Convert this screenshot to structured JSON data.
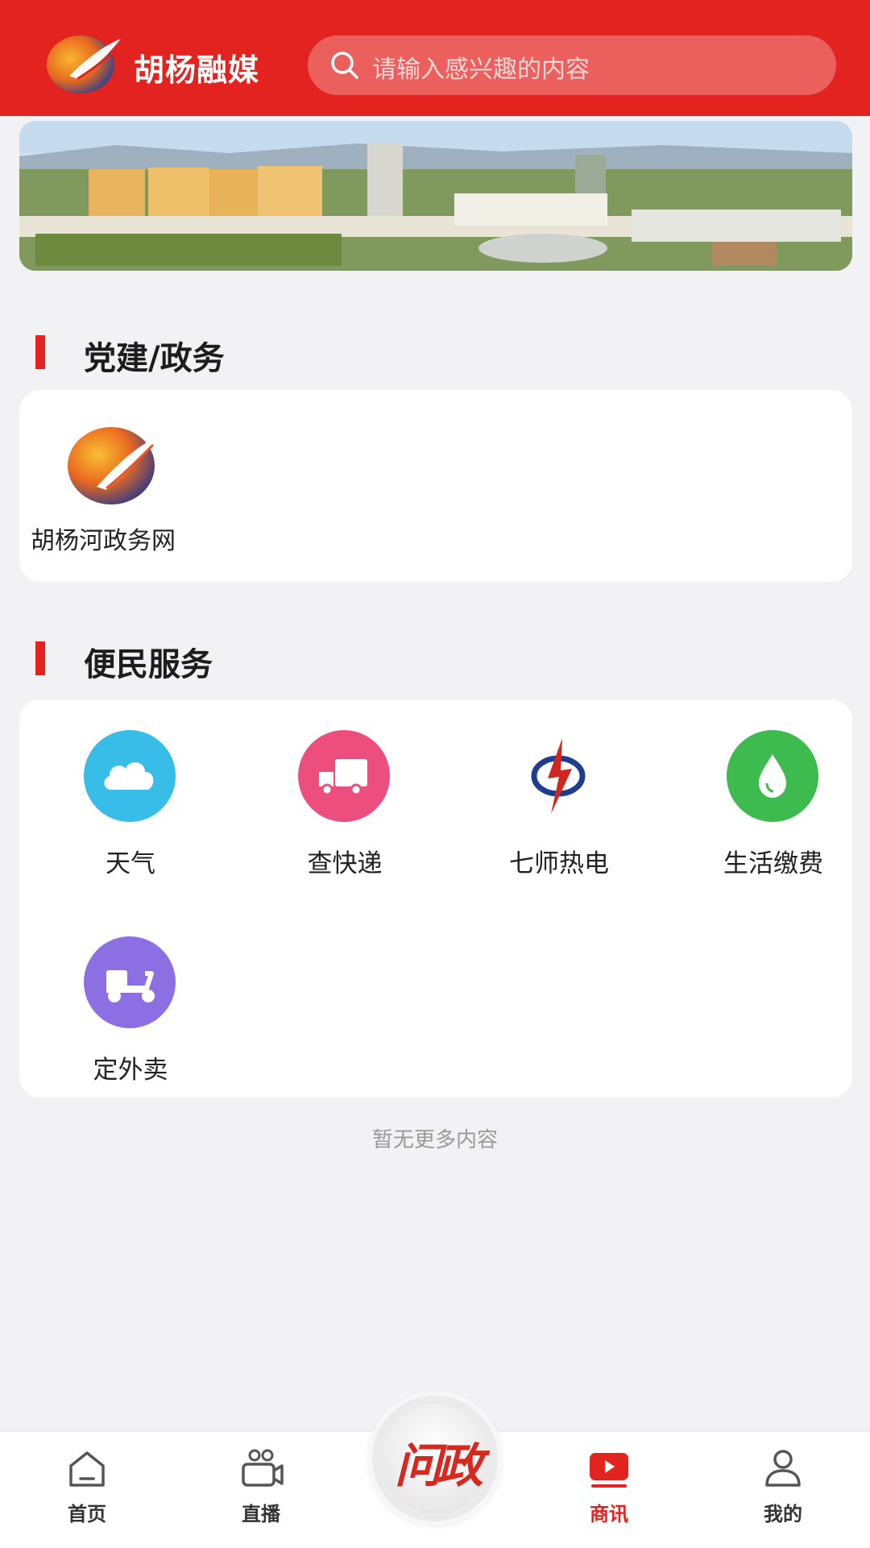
{
  "header": {
    "brand": "胡杨融媒",
    "search_placeholder": "请输入感兴趣的内容"
  },
  "sections": {
    "party": {
      "title": "党建/政务",
      "items": [
        {
          "label": "胡杨河政务网"
        }
      ]
    },
    "services": {
      "title": "便民服务",
      "items": [
        {
          "label": "天气",
          "icon": "cloud-icon",
          "color": "#38bde9"
        },
        {
          "label": "查快递",
          "icon": "delivery-truck-icon",
          "color": "#ec4f7e"
        },
        {
          "label": "七师热电",
          "icon": "power-company-logo-icon",
          "color": "#d0261f"
        },
        {
          "label": "生活缴费",
          "icon": "water-drop-icon",
          "color": "#3dbb4f"
        },
        {
          "label": "定外卖",
          "icon": "scooter-icon",
          "color": "#8c6fe3"
        }
      ]
    }
  },
  "footer_note": "暂无更多内容",
  "nav": {
    "items": [
      {
        "label": "首页",
        "icon": "home-icon"
      },
      {
        "label": "直播",
        "icon": "video-camera-icon"
      },
      {
        "label": "商讯",
        "icon": "play-icon",
        "active": true
      },
      {
        "label": "我的",
        "icon": "user-icon"
      }
    ],
    "center_label": "问政"
  },
  "colors": {
    "brand_red": "#e3231f",
    "background": "#f2f2f5"
  }
}
